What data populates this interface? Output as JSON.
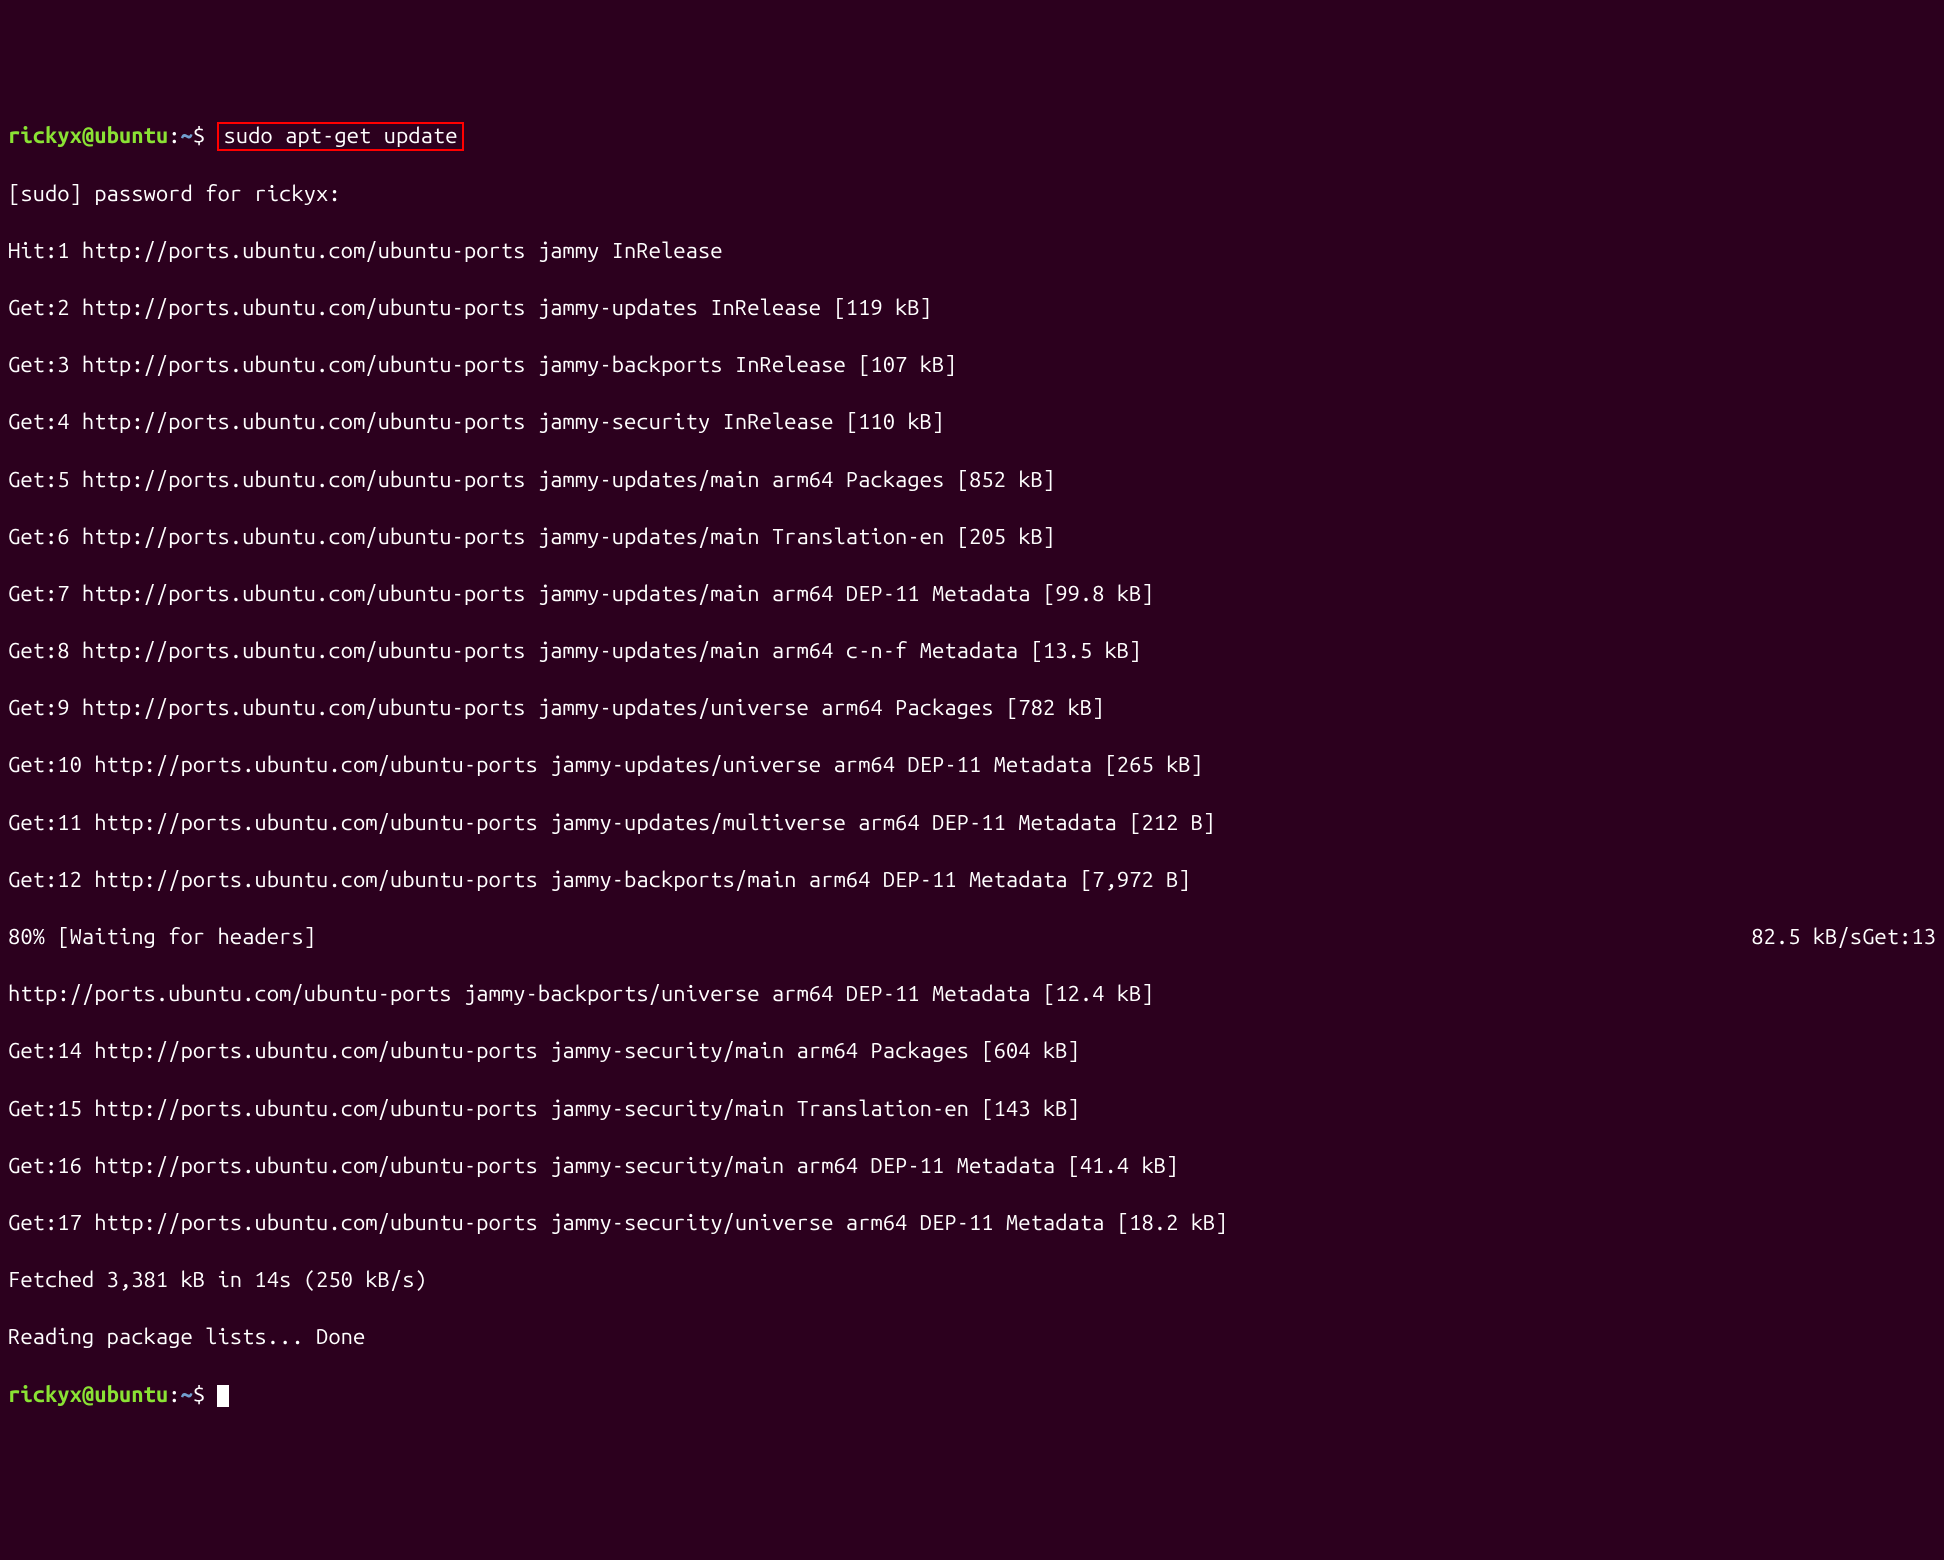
{
  "prompt": {
    "user": "rickyx",
    "at": "@",
    "host": "ubuntu",
    "colon": ":",
    "path": "~",
    "dollar": "$ ",
    "command": "sudo apt-get update"
  },
  "lines": [
    "[sudo] password for rickyx:",
    "Hit:1 http://ports.ubuntu.com/ubuntu-ports jammy InRelease",
    "Get:2 http://ports.ubuntu.com/ubuntu-ports jammy-updates InRelease [119 kB]",
    "Get:3 http://ports.ubuntu.com/ubuntu-ports jammy-backports InRelease [107 kB]",
    "Get:4 http://ports.ubuntu.com/ubuntu-ports jammy-security InRelease [110 kB]",
    "Get:5 http://ports.ubuntu.com/ubuntu-ports jammy-updates/main arm64 Packages [852 kB]",
    "Get:6 http://ports.ubuntu.com/ubuntu-ports jammy-updates/main Translation-en [205 kB]",
    "Get:7 http://ports.ubuntu.com/ubuntu-ports jammy-updates/main arm64 DEP-11 Metadata [99.8 kB]",
    "Get:8 http://ports.ubuntu.com/ubuntu-ports jammy-updates/main arm64 c-n-f Metadata [13.5 kB]",
    "Get:9 http://ports.ubuntu.com/ubuntu-ports jammy-updates/universe arm64 Packages [782 kB]",
    "Get:10 http://ports.ubuntu.com/ubuntu-ports jammy-updates/universe arm64 DEP-11 Metadata [265 kB]",
    "Get:11 http://ports.ubuntu.com/ubuntu-ports jammy-updates/multiverse arm64 DEP-11 Metadata [212 B]",
    "Get:12 http://ports.ubuntu.com/ubuntu-ports jammy-backports/main arm64 DEP-11 Metadata [7,972 B]"
  ],
  "progress": {
    "left": "80% [Waiting for headers]",
    "right": "82.5 kB/sGet:13"
  },
  "lines2": [
    "http://ports.ubuntu.com/ubuntu-ports jammy-backports/universe arm64 DEP-11 Metadata [12.4 kB]",
    "Get:14 http://ports.ubuntu.com/ubuntu-ports jammy-security/main arm64 Packages [604 kB]",
    "Get:15 http://ports.ubuntu.com/ubuntu-ports jammy-security/main Translation-en [143 kB]",
    "Get:16 http://ports.ubuntu.com/ubuntu-ports jammy-security/main arm64 DEP-11 Metadata [41.4 kB]",
    "Get:17 http://ports.ubuntu.com/ubuntu-ports jammy-security/universe arm64 DEP-11 Metadata [18.2 kB]",
    "Fetched 3,381 kB in 14s (250 kB/s)",
    "Reading package lists... Done"
  ]
}
